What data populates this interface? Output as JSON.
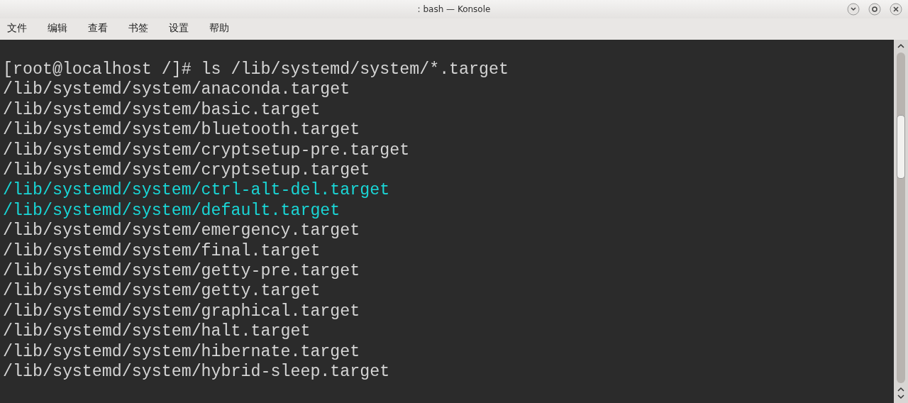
{
  "window": {
    "title": ": bash — Konsole"
  },
  "menu": [
    "文件",
    "编辑",
    "查看",
    "书签",
    "设置",
    "帮助"
  ],
  "terminal": {
    "lines": [
      {
        "text": "[root@localhost /]# ls /lib/systemd/system/*.target",
        "color": "#d4d4d4"
      },
      {
        "text": "/lib/systemd/system/anaconda.target",
        "color": "#d4d4d4"
      },
      {
        "text": "/lib/systemd/system/basic.target",
        "color": "#d4d4d4"
      },
      {
        "text": "/lib/systemd/system/bluetooth.target",
        "color": "#d4d4d4"
      },
      {
        "text": "/lib/systemd/system/cryptsetup-pre.target",
        "color": "#d4d4d4"
      },
      {
        "text": "/lib/systemd/system/cryptsetup.target",
        "color": "#d4d4d4"
      },
      {
        "text": "/lib/systemd/system/ctrl-alt-del.target",
        "color": "#1ad6d6"
      },
      {
        "text": "/lib/systemd/system/default.target",
        "color": "#1ad6d6"
      },
      {
        "text": "/lib/systemd/system/emergency.target",
        "color": "#d4d4d4"
      },
      {
        "text": "/lib/systemd/system/final.target",
        "color": "#d4d4d4"
      },
      {
        "text": "/lib/systemd/system/getty-pre.target",
        "color": "#d4d4d4"
      },
      {
        "text": "/lib/systemd/system/getty.target",
        "color": "#d4d4d4"
      },
      {
        "text": "/lib/systemd/system/graphical.target",
        "color": "#d4d4d4"
      },
      {
        "text": "/lib/systemd/system/halt.target",
        "color": "#d4d4d4"
      },
      {
        "text": "/lib/systemd/system/hibernate.target",
        "color": "#d4d4d4"
      },
      {
        "text": "/lib/systemd/system/hybrid-sleep.target",
        "color": "#d4d4d4"
      }
    ]
  }
}
